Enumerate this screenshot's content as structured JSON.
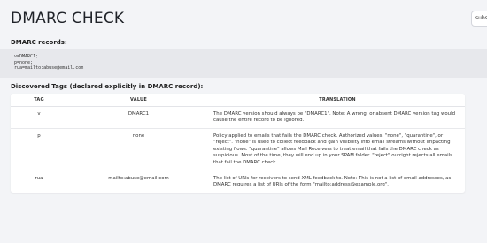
{
  "header": {
    "title": "DMARC CHECK",
    "subscribe_label": "subscribe"
  },
  "records": {
    "title": "DMARC records:",
    "lines": [
      "v=DMARC1;",
      "p=none;",
      "rua=mailto:abuse@email.com"
    ]
  },
  "tags": {
    "title": "Discovered Tags (declared explicitly in DMARC record):",
    "columns": [
      "TAG",
      "VALUE",
      "TRANSLATION"
    ],
    "rows": [
      {
        "tag": "v",
        "value": "DMARC1",
        "translation": "The DMARC version should always be \"DMARC1\". Note: A wrong, or absent DMARC version tag would cause the entire record to be ignored."
      },
      {
        "tag": "p",
        "value": "none",
        "translation": "Policy applied to emails that fails the DMARC check. Authorized values: \"none\", \"quarantine\", or \"reject\". \"none\" is used to collect feedback and gain visibility into email streams without impacting existing flows. \"quarantine\" allows Mail Receivers to treat email that fails the DMARC check as suspicious. Most of the time, they will end up in your SPAM folder. \"reject\" outright rejects all emails that fail the DMARC check."
      },
      {
        "tag": "rua",
        "value": "mailto:abuse@email.com",
        "translation": "The list of URIs for receivers to send XML feedback to. Note: This is not a list of email addresses, as DMARC requires a list of URIs of the form \"mailto:address@example.org\"."
      }
    ]
  }
}
